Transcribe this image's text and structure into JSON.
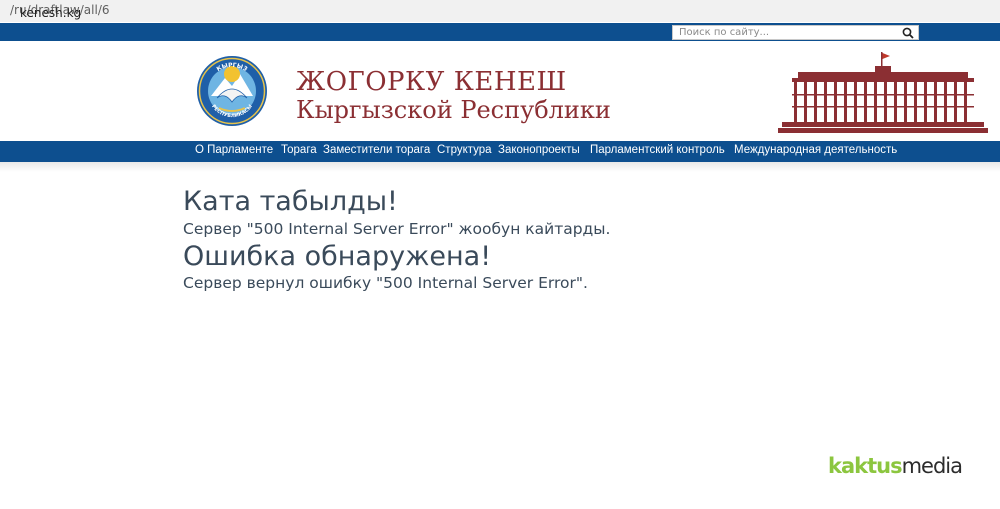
{
  "browser": {
    "url_host": "kenesh.kg",
    "url_path": "/ru/draftlaw/all/6"
  },
  "search": {
    "placeholder": "Поиск по сайту..."
  },
  "header": {
    "title_line1": "ЖОГОРКУ КЕНЕШ",
    "title_line2": "Кыргызской Республики",
    "emblem_text_top": "КЫРГЫЗ",
    "emblem_text_bottom": "РЕСПУБЛИКАСЫ"
  },
  "nav": {
    "items": [
      "О Парламенте",
      "Торага",
      "Заместители торага",
      "Структура",
      "Законопроекты",
      "Парламентский контроль",
      "Международная деятельность"
    ]
  },
  "content": {
    "heading_ky": "Ката табылды!",
    "message_ky": "Сервер \"500 Internal Server Error\" жообун кайтарды.",
    "heading_ru": "Ошибка обнаружена!",
    "message_ru": "Сервер вернул ошибку \"500 Internal Server Error\"."
  },
  "watermark": {
    "part1": "kaktus",
    "part2": "media"
  },
  "colors": {
    "brand_blue": "#0d4f8f",
    "title_red": "#8b2f33",
    "text": "#3a4a5a",
    "watermark_green": "#8cc63f"
  }
}
